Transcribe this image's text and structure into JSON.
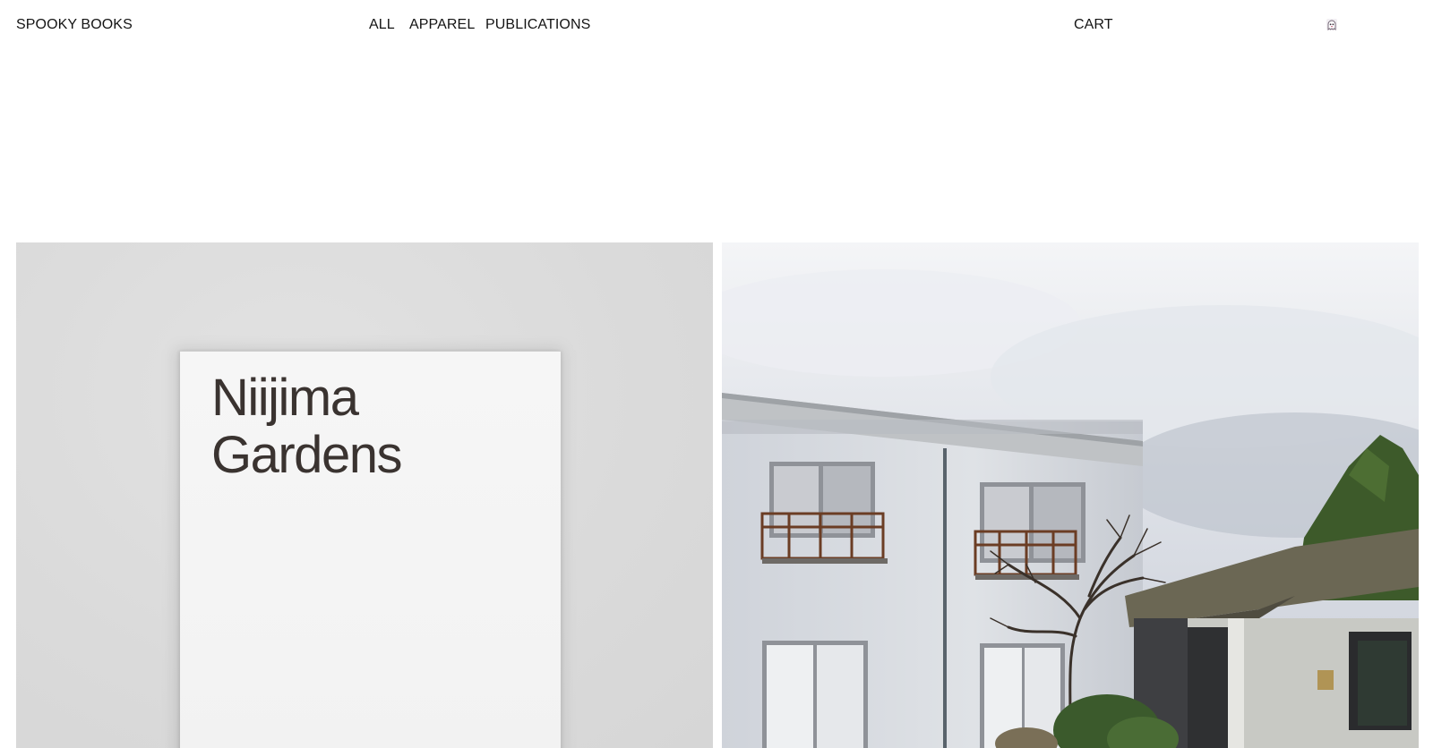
{
  "header": {
    "brand": "SPOOKY BOOKS",
    "nav": [
      {
        "label": "ALL"
      },
      {
        "label": "APPAREL"
      },
      {
        "label": "PUBLICATIONS"
      }
    ],
    "cart_label": "CART",
    "ghost_icon": "ghost-icon"
  },
  "products": {
    "left": {
      "cover_title_line1": "Niijima",
      "cover_title_line2": "Gardens"
    },
    "right": {
      "image": "house-photo"
    }
  },
  "colors": {
    "text": "#141414",
    "background": "#ffffff",
    "left_panel_bg": "#dcdcdc"
  }
}
